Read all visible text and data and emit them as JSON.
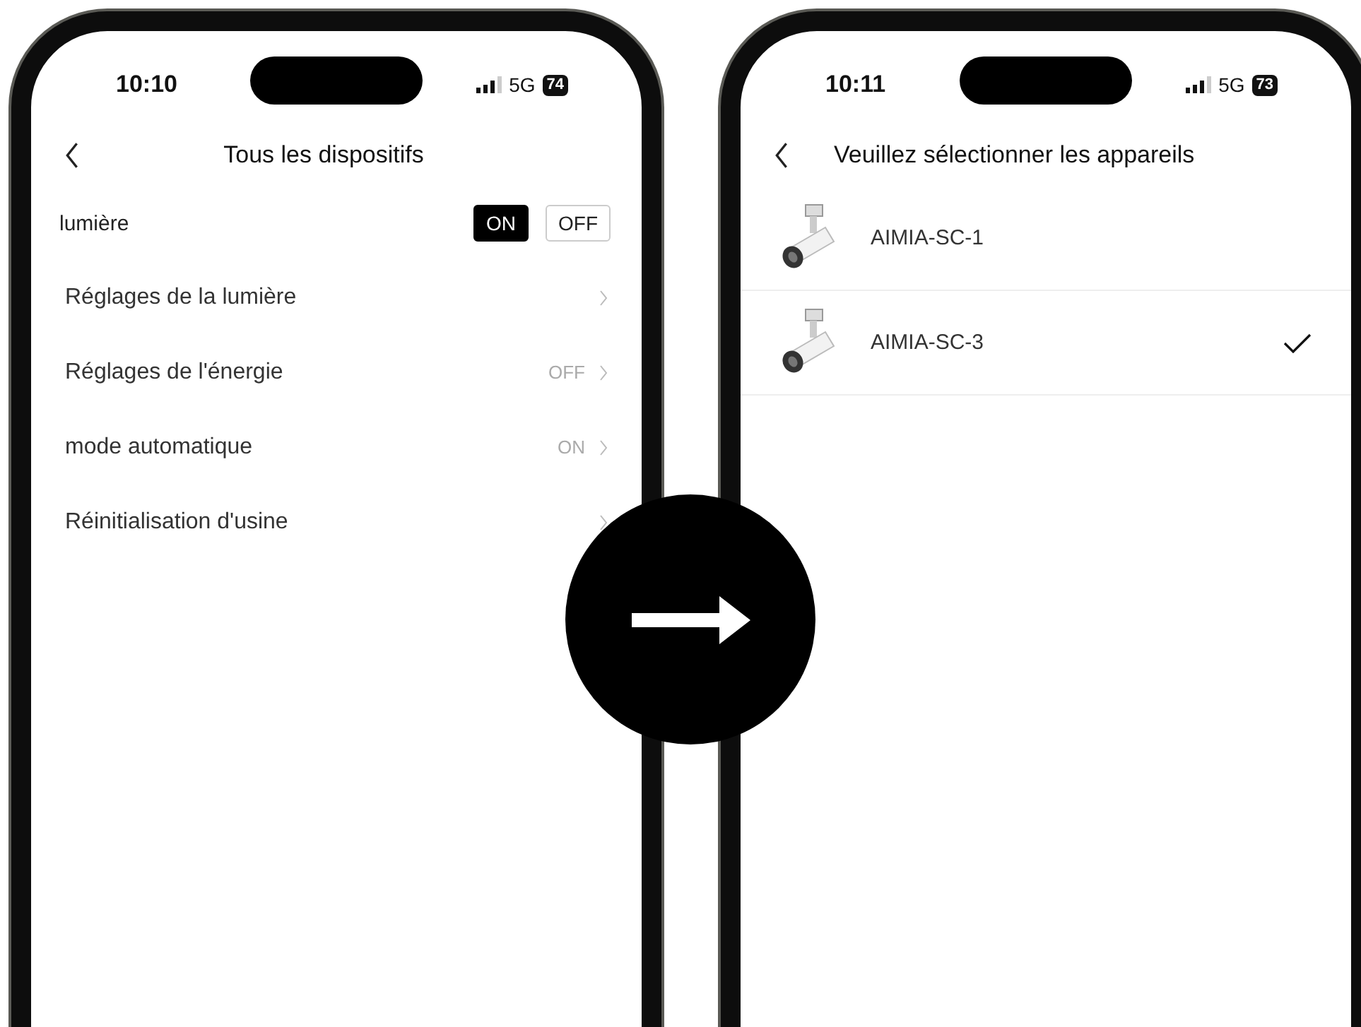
{
  "phones": [
    {
      "kind": "settings",
      "status_bar": {
        "time": "10:10",
        "network": "5G",
        "battery": "74"
      },
      "header": {
        "title": "Tous les dispositifs"
      },
      "power": {
        "label": "lumière",
        "options": [
          {
            "label": "ON",
            "selected": true
          },
          {
            "label": "OFF",
            "selected": false
          }
        ]
      },
      "settings": [
        {
          "label": "Réglages de la lumière"
        },
        {
          "label": "Réglages de l'énergie",
          "value": "OFF"
        },
        {
          "label": "mode automatique",
          "value": "ON"
        },
        {
          "label": "Réinitialisation d'usine"
        }
      ]
    },
    {
      "kind": "device_list",
      "status_bar": {
        "time": "10:11",
        "network": "5G",
        "battery": "73"
      },
      "header": {
        "title": "Veuillez sélectionner les appareils"
      },
      "devices": [
        {
          "name": "AIMIA-SC-1",
          "selected": false
        },
        {
          "name": "AIMIA-SC-3",
          "selected": true
        }
      ]
    }
  ]
}
